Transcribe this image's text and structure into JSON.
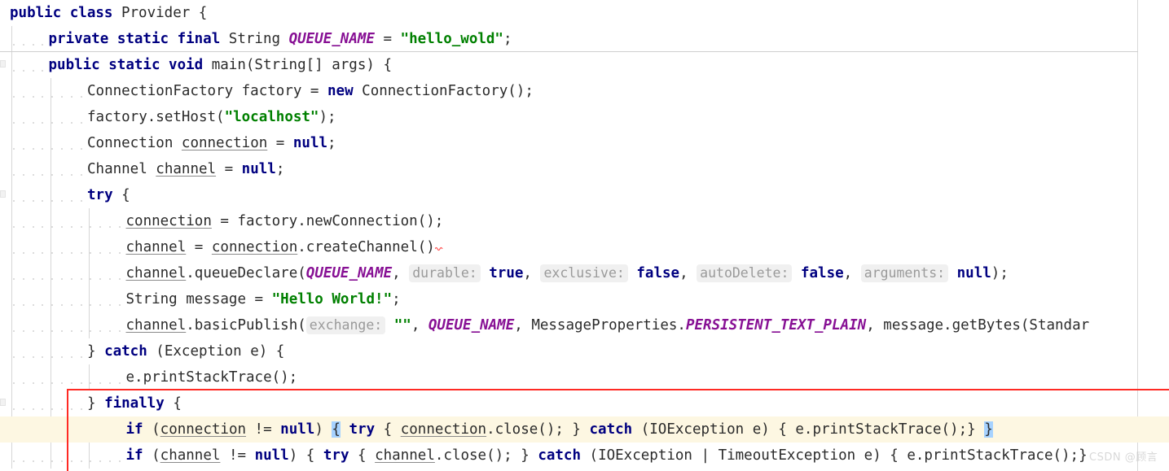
{
  "editor": {
    "language": "java",
    "class_name": "Provider",
    "colors": {
      "background": "#ffffff",
      "keyword": "#000080",
      "string": "#008000",
      "field": "#871094",
      "text": "#2b2b2b",
      "inline_hint_text": "#9a9a9a",
      "inline_hint_bg": "#f0f0f0",
      "caret_line_bg": "#fdf7e2",
      "brace_match_bg": "#a6d2ff",
      "annotation_box": "#ff2a24",
      "indent_guide": "#d6d6d6",
      "margin_guide": "#d8d8d8",
      "error_squiggle": "#ff5555"
    },
    "lines": [
      {
        "n": 1,
        "indent": 0,
        "tokens": [
          {
            "t": "public",
            "c": "kw"
          },
          {
            "t": " ",
            "c": "plain"
          },
          {
            "t": "class",
            "c": "kw"
          },
          {
            "t": " Provider {",
            "c": "plain"
          }
        ]
      },
      {
        "n": 2,
        "indent": 1,
        "separator_below": true,
        "tokens": [
          {
            "t": "private",
            "c": "kw"
          },
          {
            "t": " ",
            "c": "plain"
          },
          {
            "t": "static",
            "c": "kw"
          },
          {
            "t": " ",
            "c": "plain"
          },
          {
            "t": "final",
            "c": "kw"
          },
          {
            "t": " String ",
            "c": "plain"
          },
          {
            "t": "QUEUE_NAME",
            "c": "fld"
          },
          {
            "t": " = ",
            "c": "plain"
          },
          {
            "t": "\"hello_wold\"",
            "c": "str"
          },
          {
            "t": ";",
            "c": "plain"
          }
        ]
      },
      {
        "n": 3,
        "indent": 1,
        "tokens": [
          {
            "t": "public",
            "c": "kw"
          },
          {
            "t": " ",
            "c": "plain"
          },
          {
            "t": "static",
            "c": "kw"
          },
          {
            "t": " ",
            "c": "plain"
          },
          {
            "t": "void",
            "c": "kw"
          },
          {
            "t": " main(String[] args) {",
            "c": "plain"
          }
        ]
      },
      {
        "n": 4,
        "indent": 2,
        "tokens": [
          {
            "t": "ConnectionFactory factory = ",
            "c": "plain"
          },
          {
            "t": "new",
            "c": "kw"
          },
          {
            "t": " ConnectionFactory();",
            "c": "plain"
          }
        ]
      },
      {
        "n": 5,
        "indent": 2,
        "tokens": [
          {
            "t": "factory.setHost(",
            "c": "plain"
          },
          {
            "t": "\"localhost\"",
            "c": "str"
          },
          {
            "t": ");",
            "c": "plain"
          }
        ]
      },
      {
        "n": 6,
        "indent": 2,
        "tokens": [
          {
            "t": "Connection ",
            "c": "plain"
          },
          {
            "t": "connection",
            "c": "und"
          },
          {
            "t": " = ",
            "c": "plain"
          },
          {
            "t": "null",
            "c": "kw"
          },
          {
            "t": ";",
            "c": "plain"
          }
        ]
      },
      {
        "n": 7,
        "indent": 2,
        "tokens": [
          {
            "t": "Channel ",
            "c": "plain"
          },
          {
            "t": "channel",
            "c": "und"
          },
          {
            "t": " = ",
            "c": "plain"
          },
          {
            "t": "null",
            "c": "kw"
          },
          {
            "t": ";",
            "c": "plain"
          }
        ]
      },
      {
        "n": 8,
        "indent": 2,
        "tokens": [
          {
            "t": "try",
            "c": "kw"
          },
          {
            "t": " {",
            "c": "plain"
          }
        ]
      },
      {
        "n": 9,
        "indent": 3,
        "tokens": [
          {
            "t": "connection",
            "c": "und"
          },
          {
            "t": " = factory.newConnection();",
            "c": "plain"
          }
        ]
      },
      {
        "n": 10,
        "indent": 3,
        "error_squiggle": true,
        "tokens": [
          {
            "t": "channel",
            "c": "und"
          },
          {
            "t": " = ",
            "c": "plain"
          },
          {
            "t": "connection",
            "c": "und"
          },
          {
            "t": ".createChannel()",
            "c": "plain"
          }
        ]
      },
      {
        "n": 11,
        "indent": 3,
        "tokens": [
          {
            "t": "channel",
            "c": "und"
          },
          {
            "t": ".queueDeclare(",
            "c": "plain"
          },
          {
            "t": "QUEUE_NAME",
            "c": "fld"
          },
          {
            "t": ", ",
            "c": "plain"
          },
          {
            "t": "durable:",
            "c": "hint"
          },
          {
            "t": " ",
            "c": "plain"
          },
          {
            "t": "true",
            "c": "kw"
          },
          {
            "t": ", ",
            "c": "plain"
          },
          {
            "t": "exclusive:",
            "c": "hint"
          },
          {
            "t": " ",
            "c": "plain"
          },
          {
            "t": "false",
            "c": "kw"
          },
          {
            "t": ", ",
            "c": "plain"
          },
          {
            "t": "autoDelete:",
            "c": "hint"
          },
          {
            "t": " ",
            "c": "plain"
          },
          {
            "t": "false",
            "c": "kw"
          },
          {
            "t": ", ",
            "c": "plain"
          },
          {
            "t": "arguments:",
            "c": "hint"
          },
          {
            "t": " ",
            "c": "plain"
          },
          {
            "t": "null",
            "c": "kw"
          },
          {
            "t": ");",
            "c": "plain"
          }
        ]
      },
      {
        "n": 12,
        "indent": 3,
        "tokens": [
          {
            "t": "String message = ",
            "c": "plain"
          },
          {
            "t": "\"Hello World!\"",
            "c": "str"
          },
          {
            "t": ";",
            "c": "plain"
          }
        ]
      },
      {
        "n": 13,
        "indent": 3,
        "clipped_right": true,
        "tokens": [
          {
            "t": "channel",
            "c": "und"
          },
          {
            "t": ".basicPublish(",
            "c": "plain"
          },
          {
            "t": "exchange:",
            "c": "hint"
          },
          {
            "t": " ",
            "c": "plain"
          },
          {
            "t": "\"\"",
            "c": "str"
          },
          {
            "t": ", ",
            "c": "plain"
          },
          {
            "t": "QUEUE_NAME",
            "c": "fld"
          },
          {
            "t": ", MessageProperties.",
            "c": "plain"
          },
          {
            "t": "PERSISTENT_TEXT_PLAIN",
            "c": "fld"
          },
          {
            "t": ", message.getBytes(Standar",
            "c": "plain"
          }
        ]
      },
      {
        "n": 14,
        "indent": 2,
        "tokens": [
          {
            "t": "} ",
            "c": "plain"
          },
          {
            "t": "catch",
            "c": "kw"
          },
          {
            "t": " (Exception e) {",
            "c": "plain"
          }
        ]
      },
      {
        "n": 15,
        "indent": 3,
        "tokens": [
          {
            "t": "e.printStackTrace();",
            "c": "plain"
          }
        ]
      },
      {
        "n": 16,
        "indent": 2,
        "tokens": [
          {
            "t": "} ",
            "c": "plain"
          },
          {
            "t": "finally",
            "c": "kw"
          },
          {
            "t": " {",
            "c": "plain"
          }
        ]
      },
      {
        "n": 17,
        "indent": 3,
        "caret_line": true,
        "tokens": [
          {
            "t": "if",
            "c": "kw"
          },
          {
            "t": " (",
            "c": "plain"
          },
          {
            "t": "connection",
            "c": "und"
          },
          {
            "t": " != ",
            "c": "plain"
          },
          {
            "t": "null",
            "c": "kw"
          },
          {
            "t": ") ",
            "c": "plain"
          },
          {
            "t": "{",
            "c": "brace-hl"
          },
          {
            "t": " ",
            "c": "plain"
          },
          {
            "t": "try",
            "c": "kw"
          },
          {
            "t": " { ",
            "c": "plain"
          },
          {
            "t": "connection",
            "c": "und"
          },
          {
            "t": ".close(); } ",
            "c": "plain"
          },
          {
            "t": "catch",
            "c": "kw"
          },
          {
            "t": " (IOException e) { e.printStackTrace();} ",
            "c": "plain"
          },
          {
            "t": "}",
            "c": "brace-hl"
          }
        ]
      },
      {
        "n": 18,
        "indent": 3,
        "clipped_right": true,
        "tokens": [
          {
            "t": "if",
            "c": "kw"
          },
          {
            "t": " (",
            "c": "plain"
          },
          {
            "t": "channel",
            "c": "und"
          },
          {
            "t": " != ",
            "c": "plain"
          },
          {
            "t": "null",
            "c": "kw"
          },
          {
            "t": ") { ",
            "c": "plain"
          },
          {
            "t": "try",
            "c": "kw"
          },
          {
            "t": " { ",
            "c": "plain"
          },
          {
            "t": "channel",
            "c": "und"
          },
          {
            "t": ".close(); } ",
            "c": "plain"
          },
          {
            "t": "catch",
            "c": "kw"
          },
          {
            "t": " (IOException | TimeoutException e) { e.printStackTrace();}",
            "c": "plain"
          }
        ]
      }
    ]
  },
  "annotation": {
    "type": "red-rectangle",
    "color": "#ff2a24"
  },
  "watermark": {
    "text": "CSDN @顾言"
  }
}
